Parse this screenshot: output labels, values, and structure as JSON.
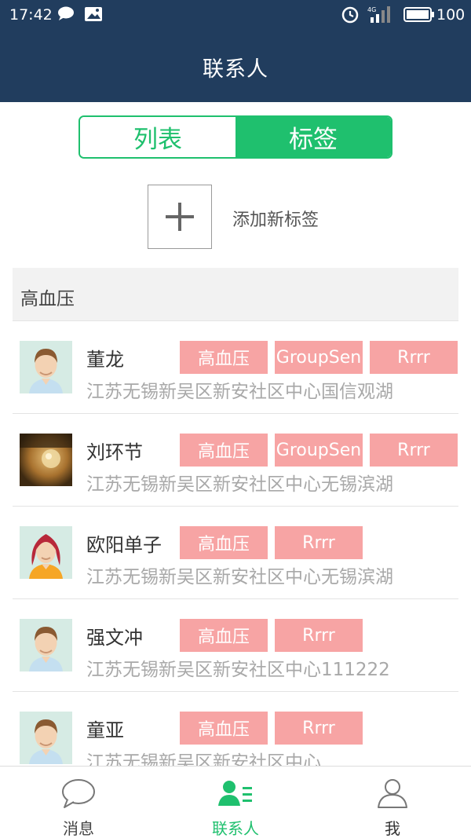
{
  "status": {
    "time": "17:42",
    "network": "4G",
    "battery": "100"
  },
  "header": {
    "title": "联系人"
  },
  "segmented": {
    "list_label": "列表",
    "tag_label": "标签",
    "selected": "标签"
  },
  "add_tag": {
    "label": "添加新标签"
  },
  "group": {
    "name": "高血压"
  },
  "contacts": [
    {
      "name": "董龙",
      "address": "江苏无锡新吴区新安社区中心国信观湖",
      "tags": [
        "高血压",
        "GroupSen",
        "Rrrr"
      ],
      "avatar": "male-avatar-icon"
    },
    {
      "name": "刘环节",
      "address": "江苏无锡新吴区新安社区中心无锡滨湖",
      "tags": [
        "高血压",
        "GroupSen",
        "Rrrr"
      ],
      "avatar": "photo-avatar"
    },
    {
      "name": "欧阳单子",
      "address": "江苏无锡新吴区新安社区中心无锡滨湖",
      "tags": [
        "高血压",
        "Rrrr"
      ],
      "avatar": "female-avatar-icon"
    },
    {
      "name": "强文冲",
      "address": "江苏无锡新吴区新安社区中心111222",
      "tags": [
        "高血压",
        "Rrrr"
      ],
      "avatar": "male-avatar-icon"
    },
    {
      "name": "童亚",
      "address": "江苏无锡新吴区新安社区中心",
      "tags": [
        "高血压",
        "Rrrr"
      ],
      "avatar": "male-avatar-icon"
    }
  ],
  "tabbar": {
    "items": [
      {
        "label": "消息",
        "icon": "chat-bubble-icon",
        "active": false
      },
      {
        "label": "联系人",
        "icon": "contacts-icon",
        "active": true
      },
      {
        "label": "我",
        "icon": "person-icon",
        "active": false
      }
    ]
  },
  "colors": {
    "header_bg": "#213d5e",
    "accent_green": "#1fc06e",
    "tag_pink": "#f7a4a4",
    "inactive_gray": "#777777"
  }
}
